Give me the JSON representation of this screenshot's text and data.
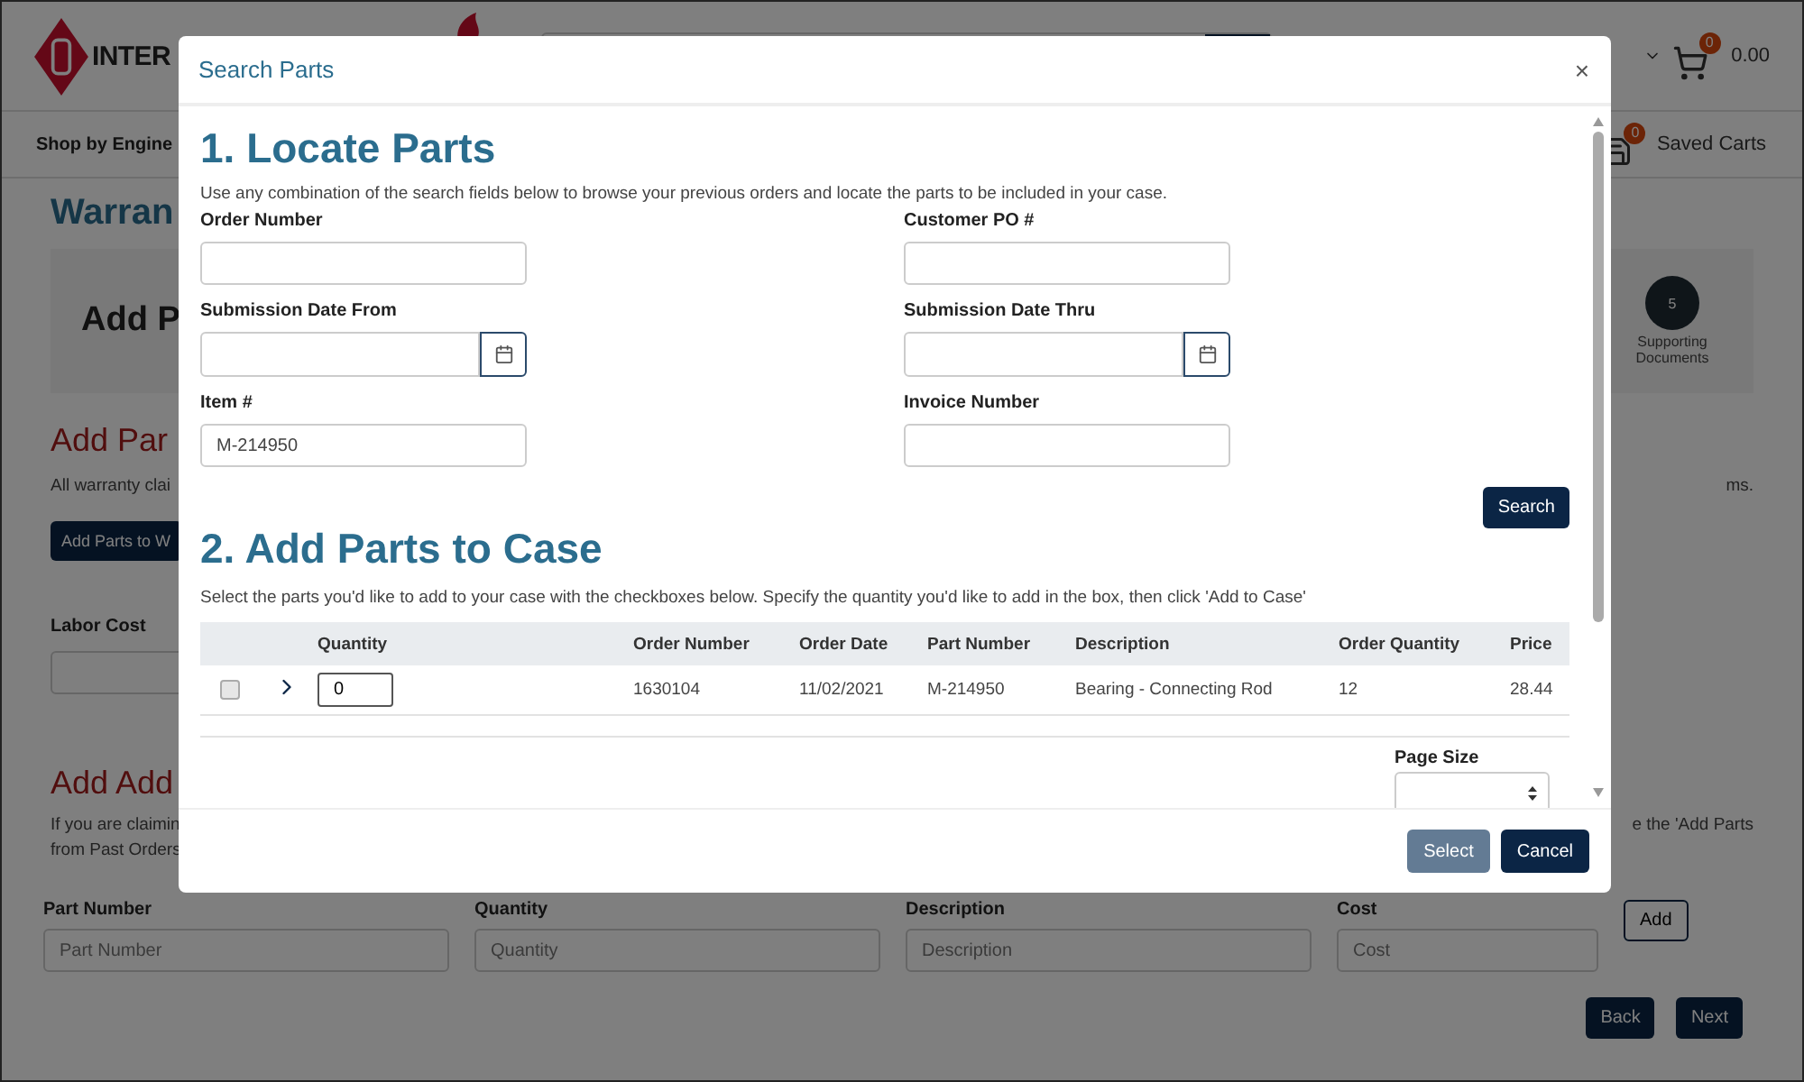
{
  "header": {
    "logo_text": "INTER",
    "cart_count": "0",
    "cart_total": "0.00"
  },
  "nav": {
    "shop_by_engine": "Shop by Engine",
    "saved_carts_count": "0",
    "saved_carts": "Saved Carts"
  },
  "page": {
    "title": "Warran",
    "step_heading": "Add P",
    "steps": [
      {
        "number": "5",
        "label": "Supporting Documents"
      }
    ],
    "section1_title": "Add Par",
    "section1_text_left": "All warranty clai",
    "section1_text_right": "ms.",
    "add_parts_button": "Add Parts to W",
    "labor_cost_label": "Labor Cost",
    "section2_title": "Add Add",
    "section2_text_left": [
      "If you are claimin",
      "from Past Orders"
    ],
    "section2_text_right": "e the 'Add Parts",
    "fields": [
      {
        "label": "Part Number",
        "placeholder": "Part Number"
      },
      {
        "label": "Quantity",
        "placeholder": "Quantity"
      },
      {
        "label": "Description",
        "placeholder": "Description"
      },
      {
        "label": "Cost",
        "placeholder": "Cost"
      }
    ],
    "add_button": "Add",
    "back_button": "Back",
    "next_button": "Next"
  },
  "modal": {
    "title": "Search Parts",
    "close": "×",
    "locate": {
      "heading": "1. Locate Parts",
      "intro": "Use any combination of the search fields below to browse your previous orders and locate the parts to be included in your case.",
      "fields": [
        {
          "label": "Order Number",
          "kind": "text"
        },
        {
          "label": "Customer PO #",
          "kind": "text"
        },
        {
          "label": "Submission Date From",
          "kind": "date"
        },
        {
          "label": "Submission Date Thru",
          "kind": "date"
        },
        {
          "label": "Item #",
          "kind": "text",
          "value": "M-214950"
        },
        {
          "label": "Invoice Number",
          "kind": "text"
        }
      ],
      "search_button": "Search"
    },
    "add": {
      "heading": "2. Add Parts to Case",
      "intro": "Select the parts you'd like to add to your case with the checkboxes below. Specify the quantity you'd like to add in the box, then click 'Add to Case'",
      "columns": [
        "Quantity",
        "Order Number",
        "Order Date",
        "Part Number",
        "Description",
        "Order Quantity",
        "Price"
      ],
      "rows": [
        {
          "checked": false,
          "expanded": false,
          "quantity": "0",
          "order_number": "1630104",
          "order_date": "11/02/2021",
          "part_number": "M-214950",
          "description": "Bearing - Connecting Rod",
          "order_quantity": "12",
          "price": "28.44"
        }
      ],
      "page_size_label": "Page Size"
    },
    "buttons": [
      {
        "label": "Select",
        "disabled": true
      },
      {
        "label": "Cancel",
        "disabled": false
      }
    ]
  }
}
